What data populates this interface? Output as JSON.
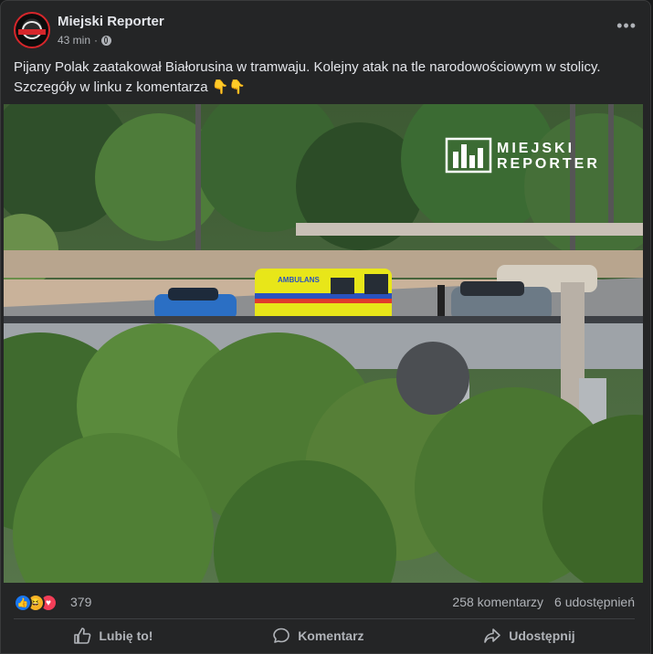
{
  "post": {
    "page_name": "Miejski Reporter",
    "time": "43 min",
    "separator": "·",
    "audience_icon": "globe-icon",
    "caption_line1": "Pijany Polak zaatakował Białorusina w tramwaju. Kolejny atak na tle narodowościowym w stolicy.",
    "caption_line2": "Szczegóły w linku z komentarza 👇👇"
  },
  "photo": {
    "watermark_line1": "MIEJSKI",
    "watermark_line2": "REPORTER",
    "ambulance_text": "AMBULANS"
  },
  "reactions": {
    "icons": [
      "like-icon",
      "haha-icon",
      "love-icon"
    ],
    "count": "379",
    "comments": "258 komentarzy",
    "shares": "6 udostępnień"
  },
  "actions": {
    "like": "Lubię to!",
    "comment": "Komentarz",
    "share": "Udostępnij"
  },
  "colors": {
    "background": "#242526",
    "text_primary": "#e4e6eb",
    "text_secondary": "#b0b3b8",
    "like_blue": "#1877f2",
    "ambulance_yellow": "#e8e619"
  }
}
